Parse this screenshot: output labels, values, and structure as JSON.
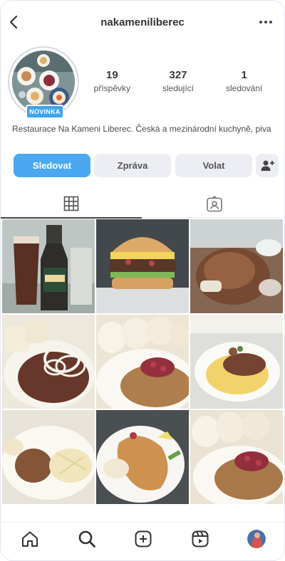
{
  "header": {
    "username": "nakameniliberec"
  },
  "profile": {
    "badge": "NOVINKA",
    "stats": [
      {
        "value": "19",
        "label": "příspěvky"
      },
      {
        "value": "327",
        "label": "sledující"
      },
      {
        "value": "1",
        "label": "sledování"
      }
    ],
    "bio": "Restaurace Na Kameni Liberec. Česká a mezinárodní kuchyně, piva"
  },
  "actions": {
    "follow": "Sledovat",
    "message": "Zpráva",
    "call": "Volat"
  },
  "grid": {
    "posts": [
      "beer-and-kozel-bottle",
      "burger",
      "roasted-pork-knee",
      "goulash-with-onions-and-dumplings",
      "dumplings-with-sauce-and-cranberries",
      "stew-with-mashed-potatoes",
      "steak-with-sauerkraut",
      "schnitzel-with-potato-salad",
      "dumplings-with-sauce-and-cranberries"
    ]
  },
  "colors": {
    "accent": "#4aa8f1",
    "button_secondary": "#eceef3"
  }
}
